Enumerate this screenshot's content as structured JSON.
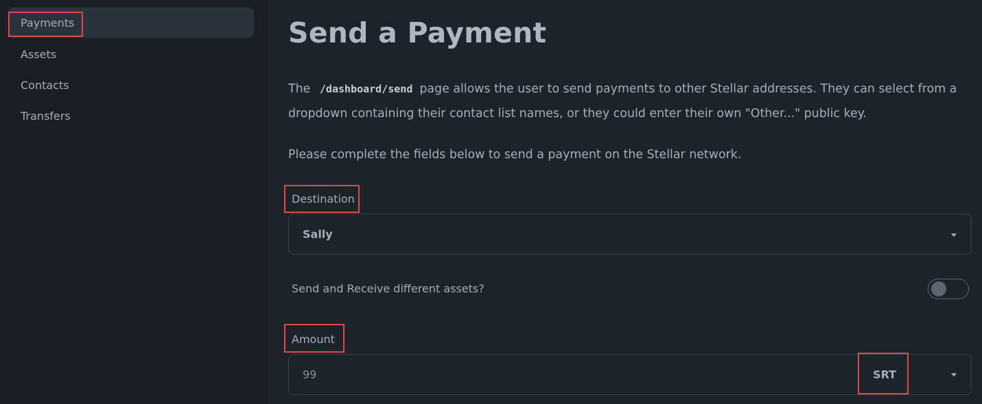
{
  "sidebar": {
    "items": [
      {
        "label": "Payments",
        "active": true
      },
      {
        "label": "Assets",
        "active": false
      },
      {
        "label": "Contacts",
        "active": false
      },
      {
        "label": "Transfers",
        "active": false
      }
    ]
  },
  "main": {
    "title": "Send a Payment",
    "intro_before": "The",
    "intro_code": "/dashboard/send",
    "intro_line1_after": "page allows the user to send payments to other Stellar addresses. They can select from a",
    "intro_line2": "dropdown containing their contact list names, or they could enter their own \"Other...\" public key.",
    "instructions": "Please complete the fields below to send a payment on the Stellar network.",
    "destination": {
      "label": "Destination",
      "value": "Sally"
    },
    "toggle": {
      "label": "Send and Receive different assets?",
      "on": false
    },
    "amount": {
      "label": "Amount",
      "value": "99",
      "asset": "SRT"
    }
  },
  "colors": {
    "background": "#1d232a",
    "sidebar": "#1a1f26",
    "active_item": "#2a323c",
    "text": "#a6adbb",
    "highlight": "#e0494a"
  }
}
